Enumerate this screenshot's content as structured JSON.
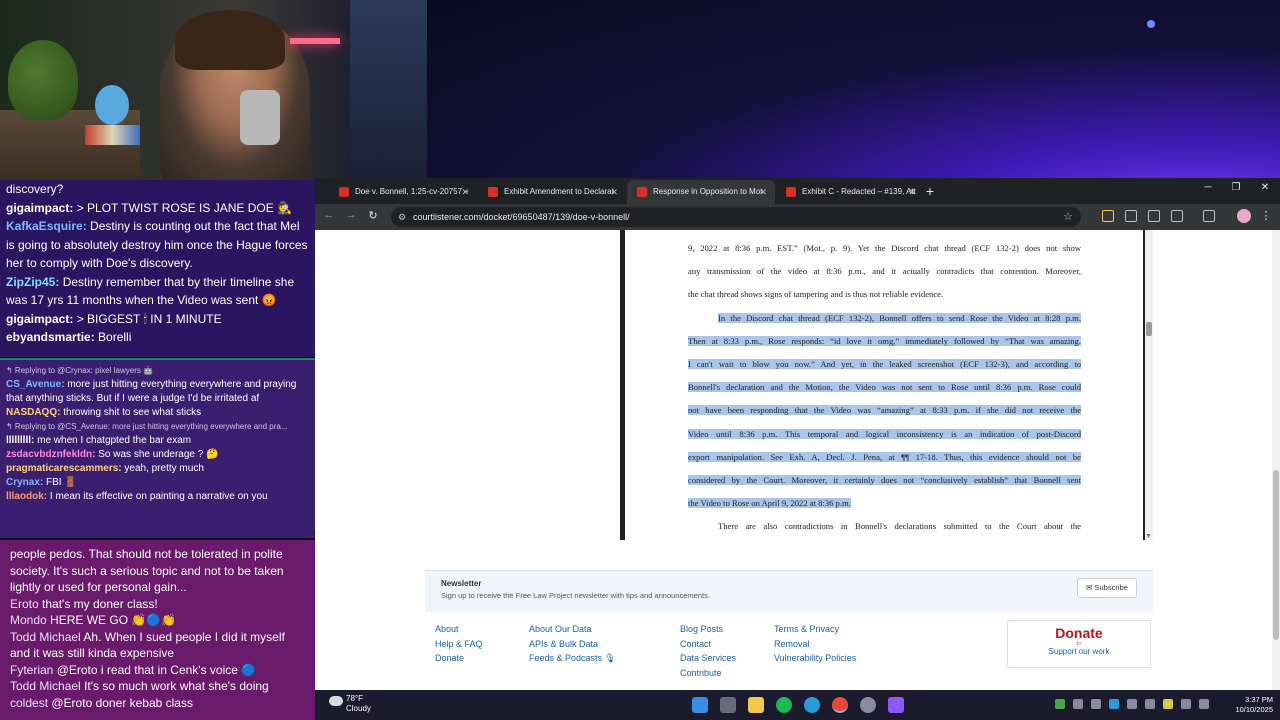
{
  "chat_top": {
    "messages": [
      {
        "user": "",
        "text": "discovery?",
        "user_color": "#ffffff"
      },
      {
        "user": "gigaimpact:",
        "text": "> PLOT TWIST ROSE IS JANE DOE 🕵️",
        "user_color": "#ffffff"
      },
      {
        "user": "KafkaEsquire:",
        "text": "Destiny is counting out the fact that Mel is going to absolutely destroy him once the Hague forces her to comply with Doe's discovery.",
        "user_color": "#7fb8ff"
      },
      {
        "user": "ZipZip45:",
        "text": "Destiny remember that by their timeline she was 17 yrs 11 months when the Video was sent 😡",
        "user_color": "#7fe0ff"
      },
      {
        "user": "gigaimpact:",
        "text": "> BIGGEST 🕯 IN 1 MINUTE",
        "user_color": "#ffffff"
      },
      {
        "user": "ebyandsmartie:",
        "text": "Borelli",
        "user_color": "#ffffff"
      }
    ]
  },
  "chat_mid": {
    "messages": [
      {
        "reply": "↰ Replying to @Crynax: pixel lawyers 🤖",
        "user": "",
        "text": ""
      },
      {
        "reply": "",
        "user": "CS_Avenue:",
        "user_color": "#7fb8ff",
        "text": "more just hitting everything everywhere and praying that anything sticks. But if I were a judge I'd be irritated af"
      },
      {
        "reply": "",
        "user": "NASDAQQ:",
        "user_color": "#ffd27f",
        "text": "throwing shit to see what sticks"
      },
      {
        "reply": "↰ Replying to @CS_Avenue: more just hitting everything everywhere and pra...",
        "user": "",
        "text": ""
      },
      {
        "reply": "",
        "user": "lllllllll:",
        "user_color": "#ffffff",
        "text": "me when I chatgpted the bar exam"
      },
      {
        "reply": "",
        "user": "zsdacvbdznfekldn:",
        "user_color": "#ff8ad8",
        "text": "So was she underage ? 🤔"
      },
      {
        "reply": "",
        "user": "pragmaticarescammers:",
        "user_color": "#ffd27f",
        "text": "yeah, pretty much"
      },
      {
        "reply": "",
        "user": "Crynax:",
        "user_color": "#7fb8ff",
        "text": "FBI 🚪"
      },
      {
        "reply": "",
        "user": "lllaodok:",
        "user_color": "#ff9a6a",
        "text": "I mean its effective on painting a narrative on you"
      }
    ]
  },
  "chat_bottom": {
    "messages": [
      {
        "user": "",
        "text": "people pedos. That should not be tolerated in polite society. It's such a serious topic and not to be taken lightly or used for personal gain..."
      },
      {
        "user": "Eroto",
        "text": "that's my doner class!"
      },
      {
        "user": "Mondo",
        "text": "HERE WE GO 👏🔵👏"
      },
      {
        "user": "Todd Michael",
        "text": "Ah. When I sued people I did it myself and it was still kinda expensive"
      },
      {
        "user": "Fyterian",
        "text": "@Eroto i read that in Cenk's voice 🔵"
      },
      {
        "user": "Todd Michael",
        "text": "It's so much work what she's doing"
      },
      {
        "user": "coldest",
        "text": "@Eroto doner kebab class"
      }
    ]
  },
  "browser": {
    "tabs": [
      {
        "label": "Doe v. Bonnell, 1:25-cv-20757 –",
        "active": false
      },
      {
        "label": "Exhibit Amendment to Declarat",
        "active": false
      },
      {
        "label": "Response in Opposition to Mot",
        "active": true
      },
      {
        "label": "Exhibit C - Redacted – #139, Att",
        "active": false
      }
    ],
    "new_tab": "+",
    "url": "courtlistener.com/docket/69650487/139/doe-v-bonnell/"
  },
  "pdf": {
    "lines": [
      {
        "text": "9, 2022 at 8:36 p.m. EST.” (Mot., p. 9). Yet the Discord chat thread (ECF 132-2) does not show",
        "hl": false
      },
      {
        "text": "any transmission of the video at 8:36 p.m., and it actually contradicts that contention. Moreover,",
        "hl": false
      },
      {
        "text": "the chat thread shows signs of tampering and is thus not reliable evidence.",
        "hl": false,
        "last": true
      },
      {
        "text": "In the Discord chat thread (ECF 132-2), Bonnell offers to send Rose the Video at 8:28 p.m.",
        "hl": true,
        "indent": true
      },
      {
        "text": "Then at 8:33 p.m., Rose responds: “id love it omg,” immediately followed by “That was amazing.",
        "hl": true
      },
      {
        "text": "I can't wait to blow you now.” And yet, in the leaked screenshot (ECF 132-3), and according to",
        "hl": true
      },
      {
        "text": "Bonnell's declaration and the Motion, the Video was not sent to Rose until 8:36 p.m. Rose could",
        "hl": true
      },
      {
        "text": "not have been responding that the Video was “amazing” at 8:33 p.m. if she did not receive the",
        "hl": true
      },
      {
        "text": "Video until 8:36 p.m. This temporal and logical inconsistency is an indication of post-Discord",
        "hl": true
      },
      {
        "text": "export manipulation. See Exh. A, Decl. J. Pena, at ¶¶ 17-18. Thus, this evidence should not be",
        "hl": true
      },
      {
        "text": "considered by the Court. Moreover, it certainly does not “conclusively establish” that Bonnell sent",
        "hl": true
      },
      {
        "text": "the Video to Rose on April 9, 2022 at 8:36 p.m.",
        "hl": true,
        "last": true
      },
      {
        "text": "There are also contradictions in Bonnell's declarations submitted to the Court about the",
        "hl": false,
        "indent": true
      }
    ]
  },
  "newsletter": {
    "title": "Newsletter",
    "subtitle": "Sign up to receive the Free Law Project newsletter with tips and announcements.",
    "button": "✉ Subscribe"
  },
  "footer": {
    "col1": [
      "About",
      "Help & FAQ",
      "Donate"
    ],
    "col2": [
      "About Our Data",
      "APIs & Bulk Data",
      "Feeds & Podcasts 🎙"
    ],
    "col3": [
      "Blog Posts",
      "Contact",
      "Data Services",
      "Contribute"
    ],
    "col4": [
      "Terms & Privacy",
      "Removal",
      "Vulnerability Policies"
    ],
    "donate_title": "Donate",
    "donate_small": "to",
    "donate_sub": "Support our work"
  },
  "taskbar": {
    "temp": "78°F",
    "condition": "Cloudy",
    "time": "3:37 PM",
    "date": "10/10/2025"
  },
  "colors": {
    "highlight": "#a9c6ea",
    "donate_red": "#b5171e",
    "link_blue": "#1a5fa8"
  }
}
